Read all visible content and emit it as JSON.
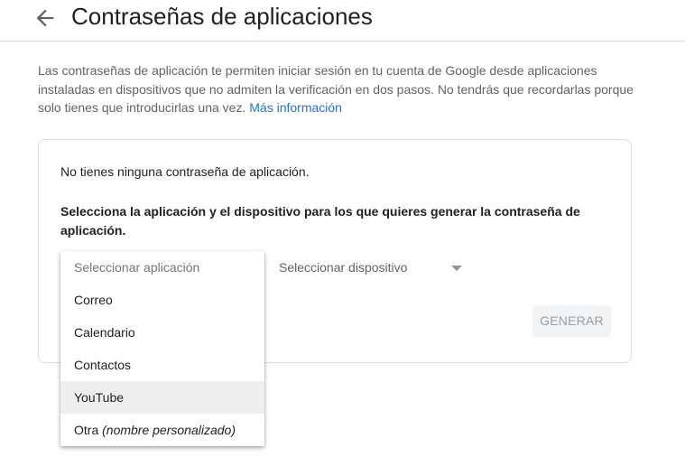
{
  "header": {
    "title": "Contraseñas de aplicaciones",
    "back_icon": "arrow-back-icon"
  },
  "intro": {
    "text": "Las contraseñas de aplicación te permiten iniciar sesión en tu cuenta de Google desde aplicaciones instaladas en dispositivos que no admiten la verificación en dos pasos. No tendrás que recordarlas porque solo tienes que introducirlas una vez.",
    "link_label": "Más información"
  },
  "card": {
    "no_passwords": "No tienes ninguna contraseña de aplicación.",
    "instruction": "Selecciona la aplicación y el dispositivo para los que quieres generar la contraseña de aplicación.",
    "device_select": {
      "placeholder": "Seleccionar dispositivo"
    },
    "generate_label": "GENERAR"
  },
  "app_dropdown": {
    "placeholder": "Seleccionar aplicación",
    "options": [
      {
        "label": "Correo"
      },
      {
        "label": "Calendario"
      },
      {
        "label": "Contactos"
      },
      {
        "label": "YouTube"
      },
      {
        "label": "Otra",
        "suffix": "(nombre personalizado)"
      }
    ],
    "highlighted": "YouTube"
  },
  "colors": {
    "link": "#1a73e8",
    "text": "#202124",
    "muted": "#5f6368",
    "border": "#dadce0",
    "disabled_bg": "#f1f3f4",
    "disabled_text": "#9aa0a6",
    "highlight_bg": "#eeeeee"
  }
}
